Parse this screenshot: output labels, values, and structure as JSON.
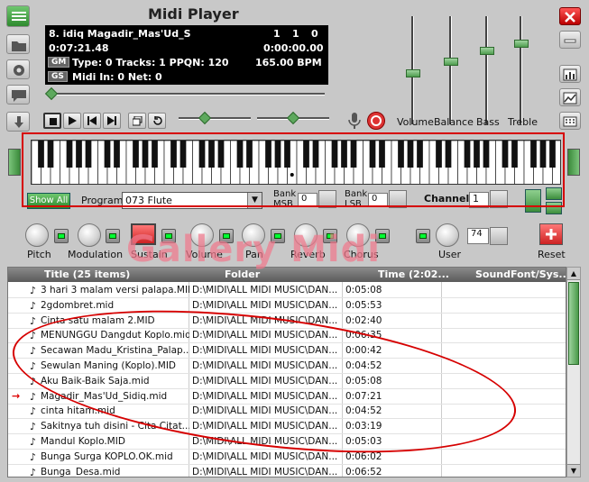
{
  "window": {
    "title": "Midi Player",
    "close_icon": "close-icon",
    "minimize_icon": "minimize-icon"
  },
  "info": {
    "song_line": "8. idiq  Magadir_Mas'Ud_S",
    "time_elapsed": "0:07:21.48",
    "counter_a": "1",
    "counter_b": "1",
    "counter_c": "0",
    "time_position": "0:00:00.00",
    "gm_tag": "GM",
    "gs_tag": "GS",
    "file_info": "Type: 0  Tracks: 1  PPQN: 120",
    "tempo": "165.00 BPM",
    "midi_info": "Midi In: 0  Net: 0"
  },
  "mixer": {
    "volume_label": "Volume",
    "balance_label": "Balance",
    "bass_label": "Bass",
    "treble_label": "Treble",
    "volume_level": 0.5,
    "balance_level": 0.62,
    "bass_level": 0.73,
    "treble_level": 0.8
  },
  "controls": {
    "show_all_label": "Show All",
    "program_label": "Program",
    "program_value": "073 Flute",
    "bank_msb_label_1": "Bank",
    "bank_msb_label_2": "MSB",
    "bank_msb_value": "0",
    "bank_lsb_label_1": "Bank",
    "bank_lsb_label_2": "LSB",
    "bank_lsb_value": "0",
    "channel_label": "Channel",
    "channel_value": "1",
    "user_value": "74"
  },
  "knobs": {
    "pitch": "Pitch",
    "modulation": "Modulation",
    "sustain": "Sustain",
    "volume": "Volume",
    "pan": "Pan",
    "reverb": "Reverb",
    "chorus": "Chorus",
    "user": "User",
    "reset": "Reset"
  },
  "watermark": "Gallery Midi",
  "playlist": {
    "col_title": "Title (25 items)",
    "col_folder": "Folder",
    "col_time": "Time (2:02...",
    "col_soundfont": "SoundFont/Sys...",
    "rows": [
      {
        "title": "3 hari 3 malam versi palapa.MID",
        "folder": "D:\\MIDI\\ALL MIDI MUSIC\\DAN...",
        "time": "0:05:08"
      },
      {
        "title": "2gdombret.mid",
        "folder": "D:\\MIDI\\ALL MIDI MUSIC\\DAN...",
        "time": "0:05:53"
      },
      {
        "title": "Cinta satu malam 2.MID",
        "folder": "D:\\MIDI\\ALL MIDI MUSIC\\DAN...",
        "time": "0:02:40"
      },
      {
        "title": "MENUNGGU Dangdut Koplo.mid",
        "folder": "D:\\MIDI\\ALL MIDI MUSIC\\DAN...",
        "time": "0:06:35"
      },
      {
        "title": "Secawan Madu_Kristina_Palap...",
        "folder": "D:\\MIDI\\ALL MIDI MUSIC\\DAN...",
        "time": "0:00:42"
      },
      {
        "title": "Sewulan Maning (Koplo).MID",
        "folder": "D:\\MIDI\\ALL MIDI MUSIC\\DAN...",
        "time": "0:04:52"
      },
      {
        "title": "Aku Baik-Baik Saja.mid",
        "folder": "D:\\MIDI\\ALL MIDI MUSIC\\DAN...",
        "time": "0:05:08"
      },
      {
        "title": "Magadir_Mas'Ud_Sidiq.mid",
        "folder": "D:\\MIDI\\ALL MIDI MUSIC\\DAN...",
        "time": "0:07:21"
      },
      {
        "title": "cinta hitam.mid",
        "folder": "D:\\MIDI\\ALL MIDI MUSIC\\DAN...",
        "time": "0:04:52"
      },
      {
        "title": "Sakitnya tuh disini - Cita Citat...",
        "folder": "D:\\MIDI\\ALL MIDI MUSIC\\DAN...",
        "time": "0:03:19"
      },
      {
        "title": "Mandul Koplo.MID",
        "folder": "D:\\MIDI\\ALL MIDI MUSIC\\DAN...",
        "time": "0:05:03"
      },
      {
        "title": "Bunga Surga KOPLO.OK.mid",
        "folder": "D:\\MIDI\\ALL MIDI MUSIC\\DAN...",
        "time": "0:06:02"
      },
      {
        "title": "Bunga_Desa.mid",
        "folder": "D:\\MIDI\\ALL MIDI MUSIC\\DAN...",
        "time": "0:06:52"
      }
    ]
  }
}
